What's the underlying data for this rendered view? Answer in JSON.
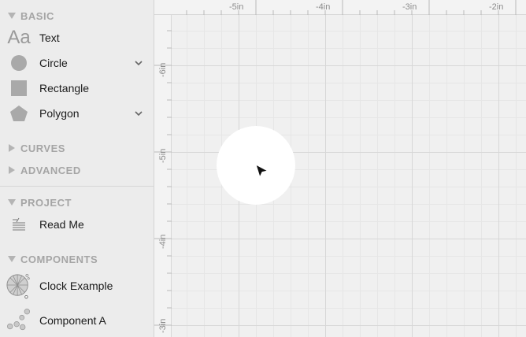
{
  "sidebar": {
    "sections": {
      "basic": "BASIC",
      "curves": "CURVES",
      "advanced": "ADVANCED",
      "project": "PROJECT",
      "components": "COMPONENTS"
    },
    "basic_items": [
      {
        "label": "Text",
        "icon": "text-aa-icon"
      },
      {
        "label": "Circle",
        "icon": "circle-icon"
      },
      {
        "label": "Rectangle",
        "icon": "rectangle-icon"
      },
      {
        "label": "Polygon",
        "icon": "polygon-icon"
      }
    ],
    "project_items": [
      {
        "label": "Read Me",
        "icon": "document-lines-icon"
      }
    ],
    "component_items": [
      {
        "label": "Clock Example",
        "icon": "clock-component-icon"
      },
      {
        "label": "Component A",
        "icon": "dots-component-icon"
      }
    ]
  },
  "text_icon_glyph": "Aa",
  "ruler": {
    "top_labels": [
      "-5in",
      "-4in",
      "-3in",
      "-2in"
    ],
    "left_labels": [
      "-6in",
      "-5in",
      "-4in",
      "-3in"
    ]
  },
  "colors": {
    "sidebar_bg": "#ececec",
    "section_header": "#a5a5a5",
    "canvas_bg": "#f0f0f0",
    "grid_major": "#d7d7d7",
    "grid_minor": "#e6e6e6",
    "shape_gray": "#a9a9a9"
  }
}
